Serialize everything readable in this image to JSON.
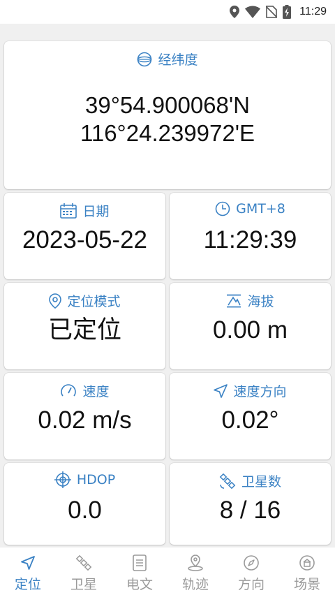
{
  "status_bar": {
    "time": "11:29"
  },
  "coords": {
    "title": "经纬度",
    "latitude": "39°54.900068'N",
    "longitude": "116°24.239972'E"
  },
  "date": {
    "title": "日期",
    "value": "2023-05-22"
  },
  "time": {
    "title": "GMT+8",
    "value": "11:29:39"
  },
  "mode": {
    "title": "定位模式",
    "value": "已定位"
  },
  "altitude": {
    "title": "海拔",
    "value": "0.00 m"
  },
  "speed": {
    "title": "速度",
    "value": "0.02 m/s"
  },
  "heading": {
    "title": "速度方向",
    "value": "0.02°"
  },
  "hdop": {
    "title": "HDOP",
    "value": "0.0"
  },
  "satellites": {
    "title": "卫星数",
    "value": "8 / 16"
  },
  "nav": {
    "items": [
      {
        "label": "定位",
        "icon": "navigation-arrow-icon",
        "active": true
      },
      {
        "label": "卫星",
        "icon": "satellite-icon",
        "active": false
      },
      {
        "label": "电文",
        "icon": "document-icon",
        "active": false
      },
      {
        "label": "轨迹",
        "icon": "location-pin-icon",
        "active": false
      },
      {
        "label": "方向",
        "icon": "compass-icon",
        "active": false
      },
      {
        "label": "场景",
        "icon": "scene-icon",
        "active": false
      }
    ]
  },
  "colors": {
    "accent": "#3b82c4",
    "inactive": "#9a9a9a",
    "background": "#f0f0f0"
  }
}
